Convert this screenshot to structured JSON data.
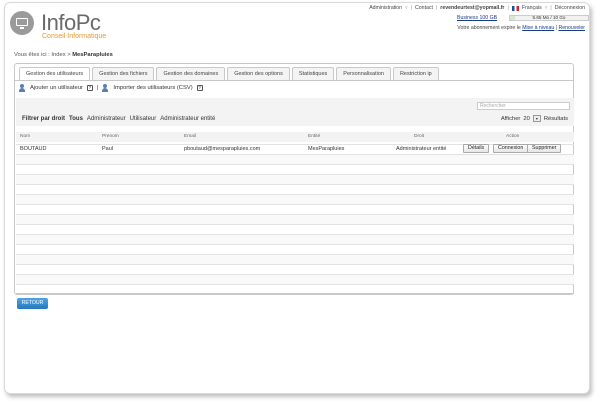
{
  "app": {
    "title": "InfoPc",
    "subtitle": "Conseil Informatique"
  },
  "topnav": {
    "administration": "Administration",
    "contact": "Contact",
    "user": "revendeurtest@yopmail.fr",
    "language": "Français",
    "logout": "Déconnexion"
  },
  "quota": {
    "plan": "Business 100 GB",
    "usage": "5.65 Mo / 10 Go",
    "fraction": 0.06
  },
  "subscription": {
    "text": "Votre abonnement expire le",
    "upgrade": "Mise à niveau",
    "renew": "Renouveler"
  },
  "breadcrumb": {
    "prefix": "Vous êtes ici :",
    "home": "Index",
    "current": "MesParapluies"
  },
  "tabs": [
    {
      "label": "Gestion des utilisateurs",
      "active": true
    },
    {
      "label": "Gestion des fichiers"
    },
    {
      "label": "Gestion des domaines"
    },
    {
      "label": "Gestion des options"
    },
    {
      "label": "Statistiques"
    },
    {
      "label": "Personnalisation"
    },
    {
      "label": "Restriction ip"
    }
  ],
  "actions": {
    "add_user": "Ajouter un utilisateur",
    "import_users": "Importer des utilisateurs (CSV)",
    "help": "?"
  },
  "search": {
    "placeholder": "Rechercher"
  },
  "filter": {
    "label": "Filtrer par droit",
    "options": [
      "Tous",
      "Administrateur",
      "Utilisateur",
      "Administrateur entité"
    ],
    "selected": "Tous"
  },
  "pagination": {
    "show_label": "Afficher",
    "per_page": "20",
    "results_label": "Résultats"
  },
  "table": {
    "columns": [
      "Nom",
      "Prenom",
      "Email",
      "Entité",
      "Droit",
      "Action"
    ],
    "rows": [
      {
        "nom": "BOUTAUD",
        "prenom": "Paul",
        "email": "pboutaud@mesparapluies.com",
        "entite": "MesParapluies",
        "droit": "Administrateur entité",
        "actions": [
          "Détails",
          "Connexion",
          "Supprimer"
        ]
      }
    ]
  },
  "footer": {
    "back": "RETOUR"
  }
}
